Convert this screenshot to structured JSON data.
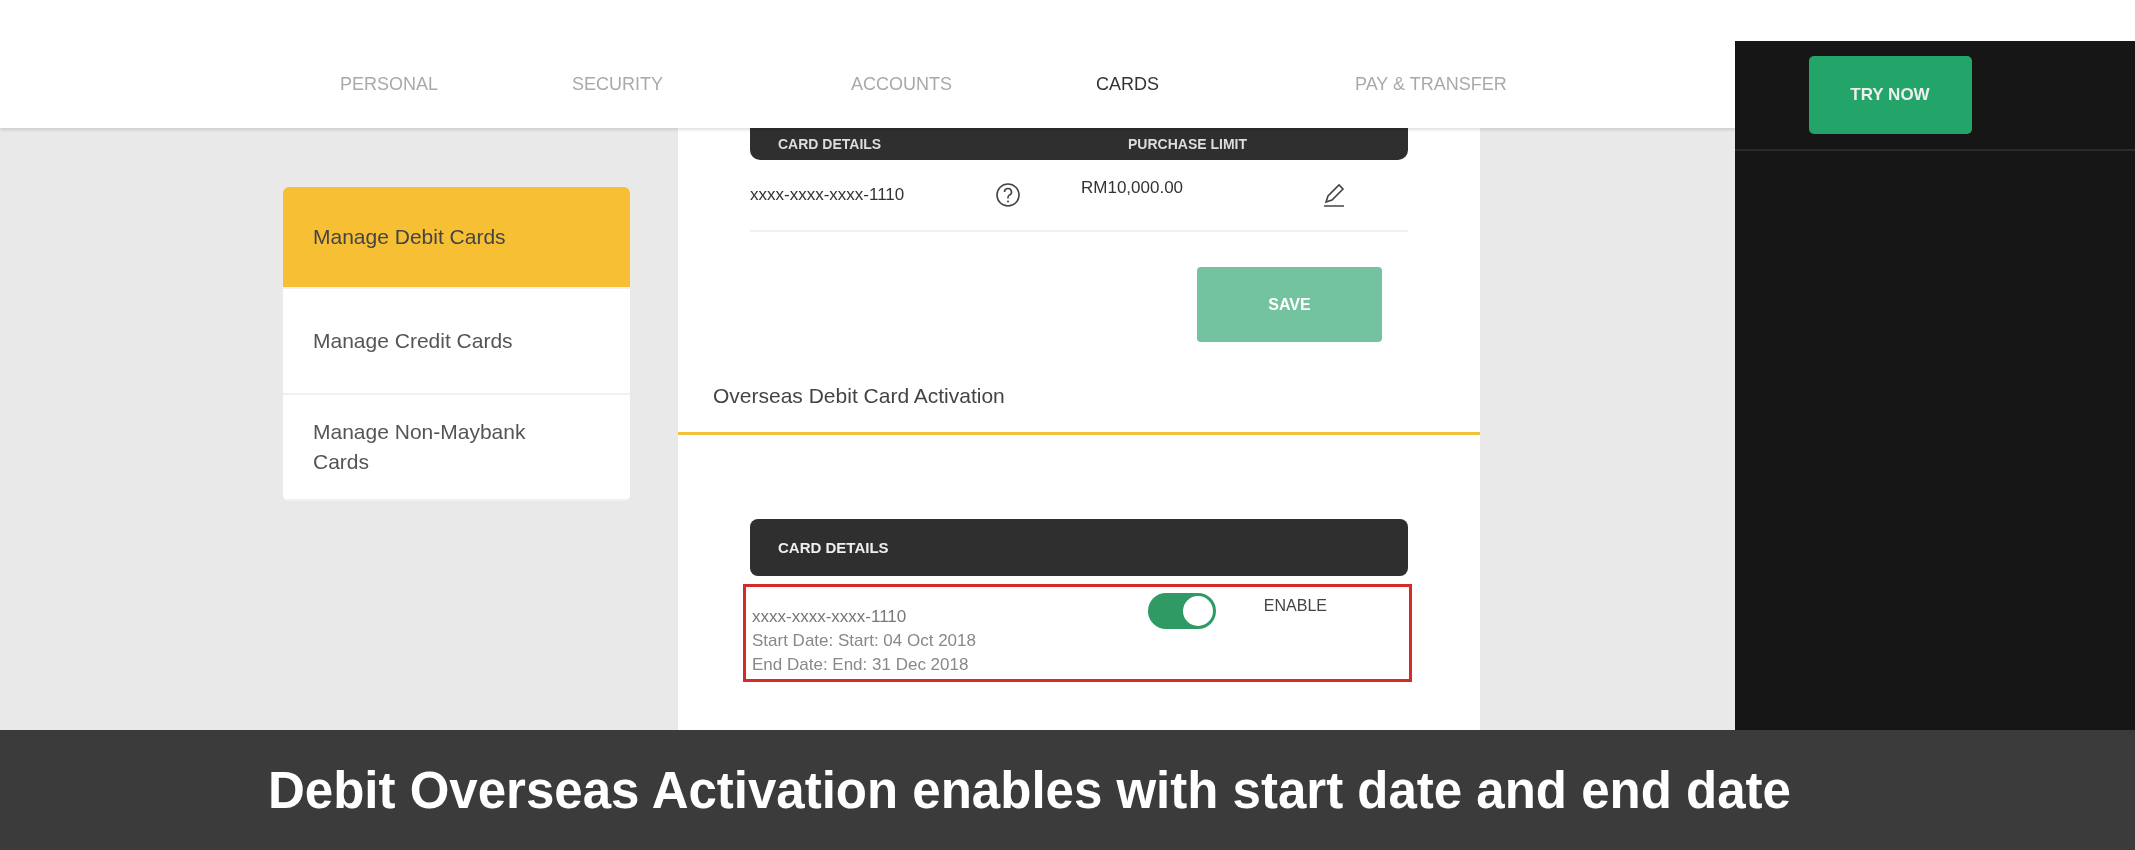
{
  "nav": {
    "tabs": [
      {
        "label": "PERSONAL",
        "selected": false
      },
      {
        "label": "SECURITY",
        "selected": false
      },
      {
        "label": "ACCOUNTS",
        "selected": false
      },
      {
        "label": "CARDS",
        "selected": true
      },
      {
        "label": "PAY & TRANSFER",
        "selected": false
      }
    ]
  },
  "sidebar": {
    "items": [
      {
        "label": "Manage Debit Cards",
        "selected": true
      },
      {
        "label": "Manage Credit Cards",
        "selected": false
      },
      {
        "label": "Manage Non-Maybank Cards",
        "selected": false
      }
    ]
  },
  "purchase_limit": {
    "columns": [
      "CARD DETAILS",
      "PURCHASE LIMIT"
    ],
    "card_number": "xxxx-xxxx-xxxx-1110",
    "limit": "RM10,000.00",
    "save_button": "SAVE"
  },
  "overseas": {
    "title": "Overseas Debit Card Activation",
    "header": "CARD DETAILS",
    "cards": [
      {
        "card_number": "xxxx-xxxx-xxxx-1110",
        "start": "Start Date: Start: 04 Oct 2018",
        "end": "End Date: End: 31 Dec 2018",
        "enabled": true,
        "toggle_label": "ENABLE",
        "highlighted": true
      }
    ]
  },
  "promo": {
    "button": "TRY NOW"
  },
  "caption": "Debit Overseas Activation enables with start date and end date"
}
